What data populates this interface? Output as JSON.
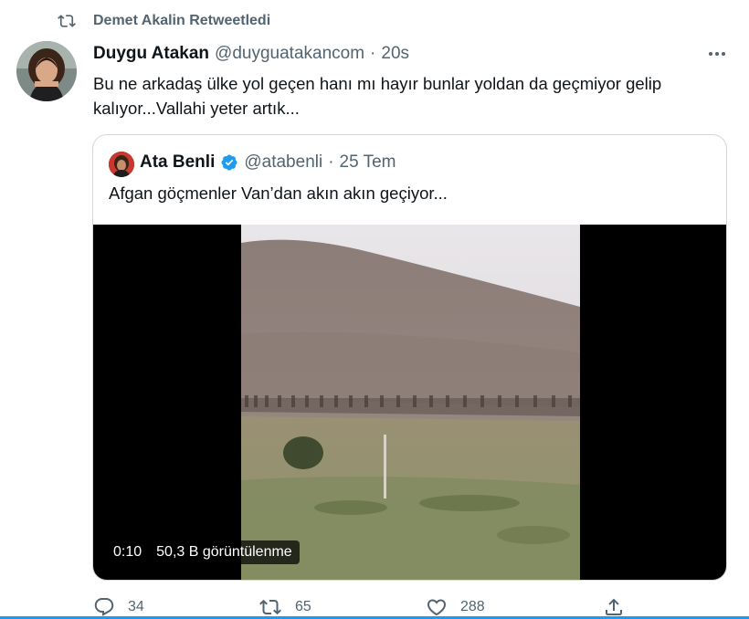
{
  "retweet": {
    "icon": "retweet-icon",
    "text": "Demet Akalin Retweetledi"
  },
  "tweet": {
    "avatar": "avatar",
    "name": "Duygu Atakan",
    "handle": "@duyguatakancom",
    "dot": "·",
    "time": "20s",
    "more_icon": "more-icon",
    "text": "Bu ne arkadaş ülke yol geçen hanı mı hayır bunlar yoldan da geçmiyor gelip kalıyor...Vallahi yeter artık..."
  },
  "quote": {
    "name": "Ata Benli",
    "verified_icon": "verified-badge-icon",
    "handle": "@atabenli",
    "dot": "·",
    "time": "25 Tem",
    "text": "Afgan göçmenler Van’dan akın akın geçiyor...",
    "video": {
      "duration": "0:10",
      "views": "50,3 B görüntülenme"
    }
  },
  "actions": {
    "reply_count": "34",
    "retweet_count": "65",
    "like_count": "288"
  },
  "colors": {
    "accent": "#1d9bf0",
    "muted": "#536471",
    "text": "#0f1419",
    "border": "#cfd9de"
  }
}
